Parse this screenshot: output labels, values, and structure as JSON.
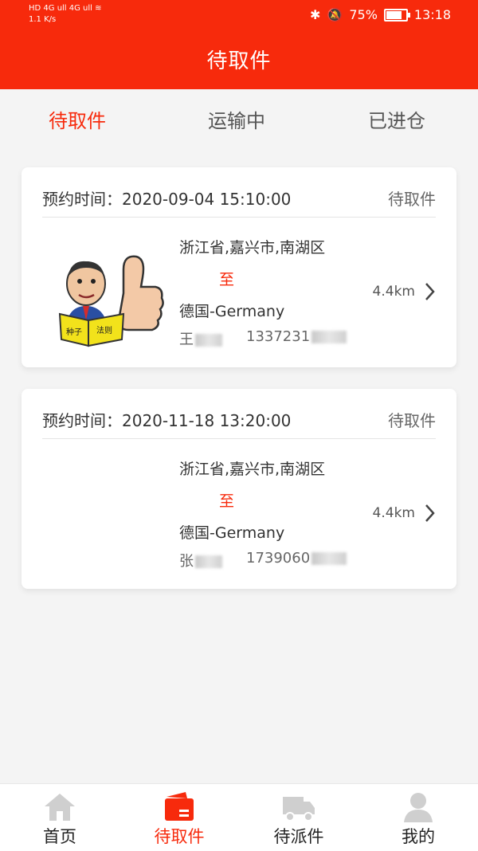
{
  "status_bar": {
    "left_line1": "HD 4G ull 4G ull ≋",
    "left_line2": "1.1 K/s",
    "battery": "75%",
    "time": "13:18"
  },
  "header": {
    "title": "待取件"
  },
  "tabs": [
    {
      "label": "待取件",
      "active": true
    },
    {
      "label": "运输中",
      "active": false
    },
    {
      "label": "已进仓",
      "active": false
    }
  ],
  "orders": [
    {
      "time_label": "预约时间：2020-09-04 15:10:00",
      "status": "待取件",
      "from": "浙江省,嘉兴市,南湖区",
      "to_label": "至",
      "dest": "德国-Germany",
      "name": "王",
      "phone": "1337231",
      "distance": "4.4km",
      "has_image": true
    },
    {
      "time_label": "预约时间：2020-11-18 13:20:00",
      "status": "待取件",
      "from": "浙江省,嘉兴市,南湖区",
      "to_label": "至",
      "dest": "德国-Germany",
      "name": "张",
      "phone": "1739060",
      "distance": "4.4km",
      "has_image": false
    }
  ],
  "bottom_nav": [
    {
      "label": "首页",
      "icon": "home-icon",
      "active": false
    },
    {
      "label": "待取件",
      "icon": "package-icon",
      "active": true
    },
    {
      "label": "待派件",
      "icon": "truck-icon",
      "active": false
    },
    {
      "label": "我的",
      "icon": "user-icon",
      "active": false
    }
  ],
  "colors": {
    "accent": "#f72a0c",
    "background": "#f4f4f4"
  }
}
